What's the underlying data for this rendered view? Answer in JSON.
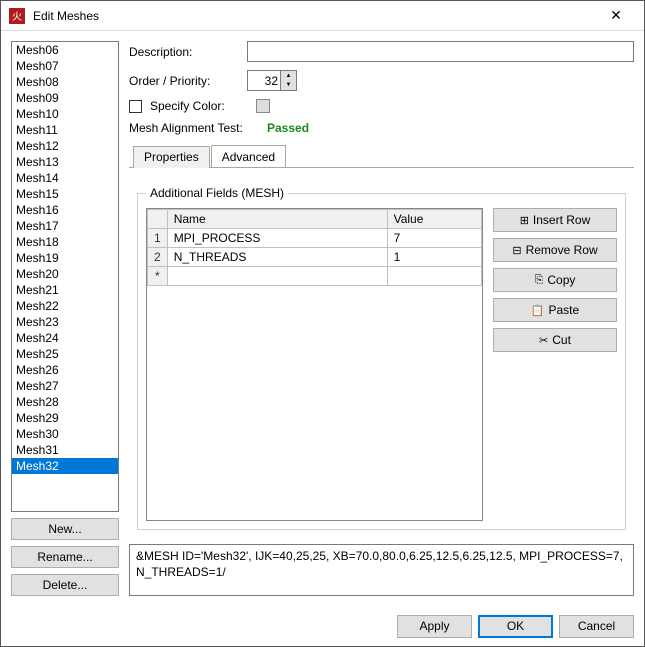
{
  "window": {
    "title": "Edit Meshes"
  },
  "meshList": {
    "items": [
      "Mesh06",
      "Mesh07",
      "Mesh08",
      "Mesh09",
      "Mesh10",
      "Mesh11",
      "Mesh12",
      "Mesh13",
      "Mesh14",
      "Mesh15",
      "Mesh16",
      "Mesh17",
      "Mesh18",
      "Mesh19",
      "Mesh20",
      "Mesh21",
      "Mesh22",
      "Mesh23",
      "Mesh24",
      "Mesh25",
      "Mesh26",
      "Mesh27",
      "Mesh28",
      "Mesh29",
      "Mesh30",
      "Mesh31",
      "Mesh32"
    ],
    "selected": "Mesh32"
  },
  "buttons": {
    "new": "New...",
    "rename": "Rename...",
    "delete": "Delete...",
    "insertRow": "Insert Row",
    "removeRow": "Remove Row",
    "copy": "Copy",
    "paste": "Paste",
    "cut": "Cut",
    "apply": "Apply",
    "ok": "OK",
    "cancel": "Cancel"
  },
  "labels": {
    "description": "Description:",
    "order": "Order / Priority:",
    "specifyColor": "Specify Color:",
    "alignmentTest": "Mesh Alignment Test:",
    "testResult": "Passed",
    "tabProperties": "Properties",
    "tabAdvanced": "Advanced",
    "fieldsetLegend": "Additional Fields (MESH)",
    "colName": "Name",
    "colValue": "Value"
  },
  "form": {
    "description": "",
    "order": "32"
  },
  "gridRows": [
    {
      "num": "1",
      "name": "MPI_PROCESS",
      "value": "7"
    },
    {
      "num": "2",
      "name": "N_THREADS",
      "value": "1"
    },
    {
      "num": "*",
      "name": "",
      "value": ""
    }
  ],
  "output": "&MESH ID='Mesh32', IJK=40,25,25, XB=70.0,80.0,6.25,12.5,6.25,12.5, MPI_PROCESS=7, N_THREADS=1/"
}
